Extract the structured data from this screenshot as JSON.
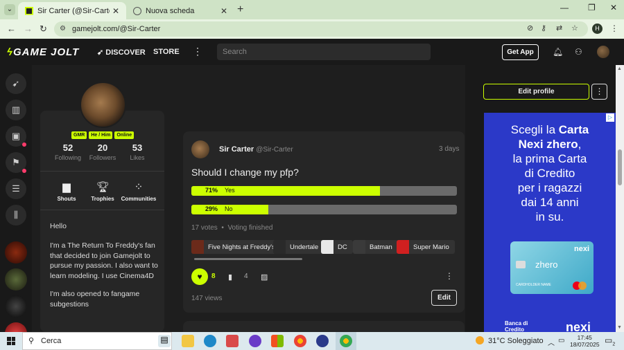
{
  "browser": {
    "tabs": [
      {
        "title": "Sir Carter (@Sir-Carter) - Game",
        "close": "✕"
      },
      {
        "title": "Nuova scheda",
        "close": "✕"
      }
    ],
    "new_tab": "+",
    "url": "gamejolt.com/@Sir-Carter",
    "profile_initial": "H",
    "window_controls": {
      "minimize": "—",
      "maximize": "❐",
      "close": "✕"
    }
  },
  "site": {
    "logo": "GAME JOLT",
    "nav": {
      "discover": "DISCOVER",
      "store": "STORE"
    },
    "search_placeholder": "Search",
    "get_app": "Get App"
  },
  "profile": {
    "badges": [
      "GMR",
      "He / Him",
      "Online"
    ],
    "stats": [
      {
        "value": "52",
        "label": "Following"
      },
      {
        "value": "20",
        "label": "Followers"
      },
      {
        "value": "53",
        "label": "Likes"
      }
    ],
    "buttons": [
      {
        "label": "Shouts",
        "icon": "shouts-icon"
      },
      {
        "label": "Trophies",
        "icon": "trophy-icon"
      },
      {
        "label": "Communities",
        "icon": "communities-icon"
      }
    ],
    "bio": [
      "Hello",
      "I'm a The Return To Freddy's fan that decided to join Gamejolt to pursue my passion. I also want to learn modeling. I use Cinema4D",
      "I'm also opened to fangame subgestions"
    ]
  },
  "post": {
    "author": "Sir Carter",
    "handle": "@Sir-Carter",
    "time": "3 days",
    "question": "Should I change my pfp?",
    "poll": [
      {
        "pct": "71%",
        "label": "Yes",
        "fraction": 0.71
      },
      {
        "pct": "29%",
        "label": "No",
        "fraction": 0.29
      }
    ],
    "votes": "17 votes",
    "status": "Voting finished",
    "tags": [
      {
        "label": "Five Nights at Freddy's",
        "color": "#6b2a1a"
      },
      {
        "label": "Undertale",
        "color": "#2a2a2a"
      },
      {
        "label": "DC",
        "color": "#e8e8e8"
      },
      {
        "label": "Batman",
        "color": "#3a3a3a"
      },
      {
        "label": "Super Mario",
        "color": "#d02020"
      }
    ],
    "likes": "8",
    "comments": "4",
    "views": "147 views",
    "edit": "Edit"
  },
  "sidebar_right": {
    "edit_profile": "Edit profile",
    "ad": {
      "line1": "Scegli la ",
      "line1b": "Carta",
      "line2b": "Nexi zhero",
      "line2": ",",
      "lines": [
        "la prima Carta",
        "di Credito",
        "per i ragazzi",
        "dai 14 anni",
        "in su."
      ],
      "card_brand": "nexi",
      "card_name": "zhero",
      "card_holder": "CARDHOLDER NAME",
      "footer_left": "Banca di Credito Popolare",
      "footer_right": "nexi"
    }
  },
  "taskbar": {
    "search": "Cerca",
    "weather": "31°C  Soleggiato",
    "time": "17:45",
    "date": "18/07/2025",
    "notifications": "2"
  },
  "colors": {
    "accent": "#ccff00",
    "background": "#191919",
    "card": "#262626",
    "ad_blue": "#2b39c8"
  }
}
